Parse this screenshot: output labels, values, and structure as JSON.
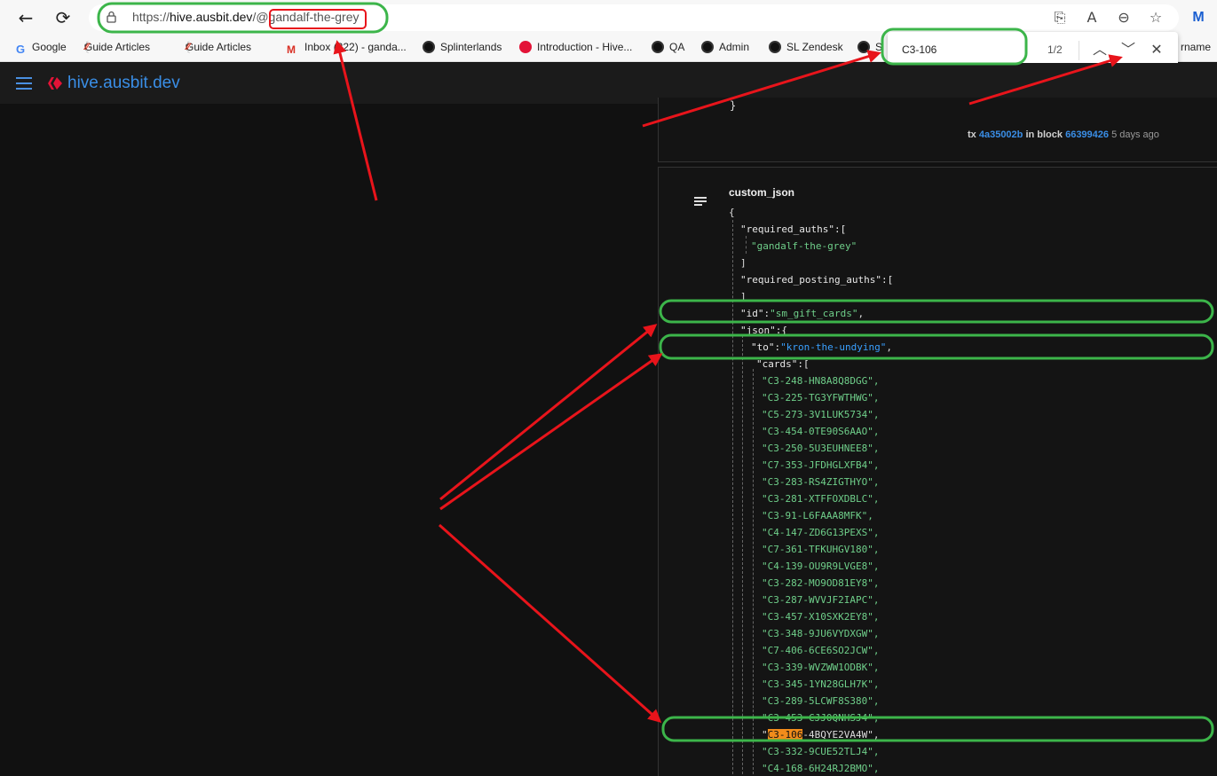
{
  "browser": {
    "url_prefix": "https://",
    "url_host": "hive.ausbit.dev",
    "url_path_pre": "/@",
    "url_account": "gandalf-the-grey",
    "bookmarks": [
      {
        "label": "Google",
        "icon": "google-icon"
      },
      {
        "label": "Guide Articles",
        "icon": "guide-icon"
      },
      {
        "label": "Guide Articles",
        "icon": "guide-icon"
      },
      {
        "label": "Inbox (222) - ganda...",
        "icon": "gmail-icon"
      },
      {
        "label": "Splinterlands",
        "icon": "splinterlands-icon"
      },
      {
        "label": "Introduction - Hive...",
        "icon": "hive-icon"
      },
      {
        "label": "QA",
        "icon": "splinterlands-icon"
      },
      {
        "label": "Admin",
        "icon": "splinterlands-icon"
      },
      {
        "label": "SL Zendesk",
        "icon": "splinterlands-icon"
      },
      {
        "label": "S",
        "icon": "splinterlands-icon"
      },
      {
        "label": "rname",
        "icon": ""
      }
    ]
  },
  "find": {
    "query": "C3-106",
    "count": "1/2"
  },
  "app": {
    "title": "hive.ausbit.dev"
  },
  "prev_tx": {
    "closing_brace": "}",
    "tx_label": "tx",
    "tx_id": "4a35002b",
    "in_block": "in block",
    "block": "66399426",
    "ago": "5 days ago"
  },
  "operation": {
    "type": "custom_json",
    "open_brace": "{",
    "required_auths_key": "\"required_auths\":[",
    "auth_account": "\"gandalf-the-grey\"",
    "close_bracket": "]",
    "required_posting_auths_key": "\"required_posting_auths\":[",
    "id_key": "\"id\":",
    "id_value": "\"sm_gift_cards\"",
    "json_key": "\"json\":{",
    "to_key": "\"to\":",
    "to_value": "\"kron-the-undying\"",
    "cards_key": "\"cards\":[",
    "cards_before": [
      "C3-248-HN8A8Q8DGG",
      "C3-225-TG3YFWTHWG",
      "C5-273-3V1LUK5734",
      "C3-454-0TE90S6AAO",
      "C3-250-5U3EUHNEE8",
      "C7-353-JFDHGLXFB4",
      "C3-283-RS4ZIGTHYO",
      "C3-281-XTFFOXDBLC",
      "C3-91-L6FAAA8MFK",
      "C4-147-ZD6G13PEXS",
      "C7-361-TFKUHGV180",
      "C4-139-OU9R9LVGE8",
      "C3-282-MO9OD81EY8",
      "C3-287-WVVJF2IAPC",
      "C3-457-X10SXK2EY8",
      "C3-348-9JU6VYDXGW",
      "C7-406-6CE6SO2JCW",
      "C3-339-WVZWW1ODBK",
      "C3-345-1YN28GLH7K",
      "C3-289-5LCWF8S380",
      "C3-453-CJJ0QNHSJ4"
    ],
    "highlight_match": "C3-106",
    "highlight_rest": "-4BQYE2VA4W",
    "cards_after": [
      "C3-332-9CUE52TLJ4",
      "C4-168-6H24RJ2BMO"
    ]
  },
  "colors": {
    "annotation_green": "#3cb54a",
    "annotation_red": "#e8141b",
    "match_highlight": "#f28c1b",
    "link_blue": "#3a8ee6"
  }
}
